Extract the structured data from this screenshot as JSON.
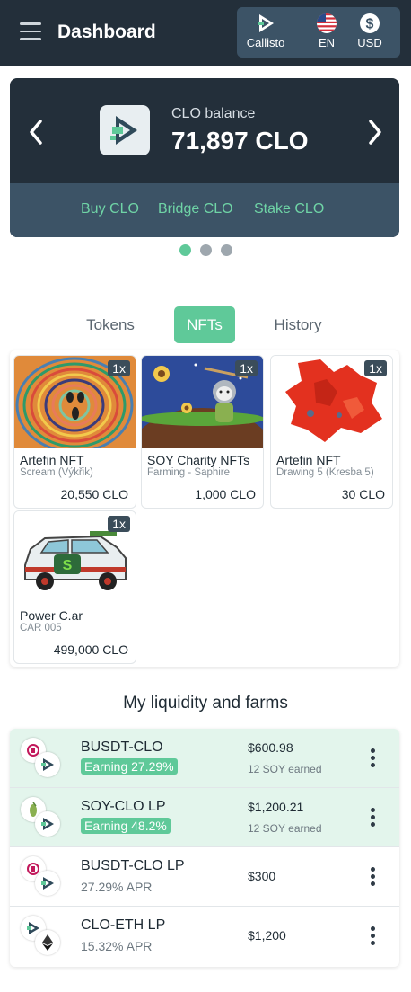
{
  "header": {
    "title": "Dashboard",
    "network_label": "Callisto",
    "language_label": "EN",
    "currency_label": "USD"
  },
  "balance": {
    "label": "CLO balance",
    "value": "71,897 CLO",
    "actions": [
      "Buy CLO",
      "Bridge CLO",
      "Stake CLO"
    ],
    "carousel_active_index": 0,
    "carousel_count": 3
  },
  "tabs": [
    {
      "label": "Tokens",
      "active": false
    },
    {
      "label": "NFTs",
      "active": true
    },
    {
      "label": "History",
      "active": false
    }
  ],
  "nfts": [
    {
      "title": "Artefin NFT",
      "subtitle": "Scream (Výkřik)",
      "price": "20,550 CLO",
      "qty": "1x"
    },
    {
      "title": "SOY Charity NFTs",
      "subtitle": "Farming - Saphire",
      "price": "1,000 CLO",
      "qty": "1x"
    },
    {
      "title": "Artefin NFT",
      "subtitle": "Drawing 5 (Kresba 5)",
      "price": "30 CLO",
      "qty": "1x"
    },
    {
      "title": "Power C.ar",
      "subtitle": "CAR 005",
      "price": "499,000 CLO",
      "qty": "1x"
    }
  ],
  "liquidity": {
    "title": "My liquidity and farms",
    "rows": [
      {
        "name": "BUSDT-CLO",
        "earning": "Earning 27.29%",
        "value": "$600.98",
        "earned": "12 SOY earned"
      },
      {
        "name": "SOY-CLO LP",
        "earning": "Earning 48.2%",
        "value": "$1,200.21",
        "earned": "12 SOY earned"
      },
      {
        "name": "BUSDT-CLO LP",
        "apr": "27.29% APR",
        "value": "$300"
      },
      {
        "name": "CLO-ETH LP",
        "apr": "15.32% APR",
        "value": "$1,200"
      }
    ]
  },
  "colors": {
    "header_bg": "#232f3a",
    "panel_blue": "#3c5366",
    "accent_green": "#5fc999",
    "link_green": "#6fd4a6",
    "row_green_bg": "#e3f5ec"
  }
}
